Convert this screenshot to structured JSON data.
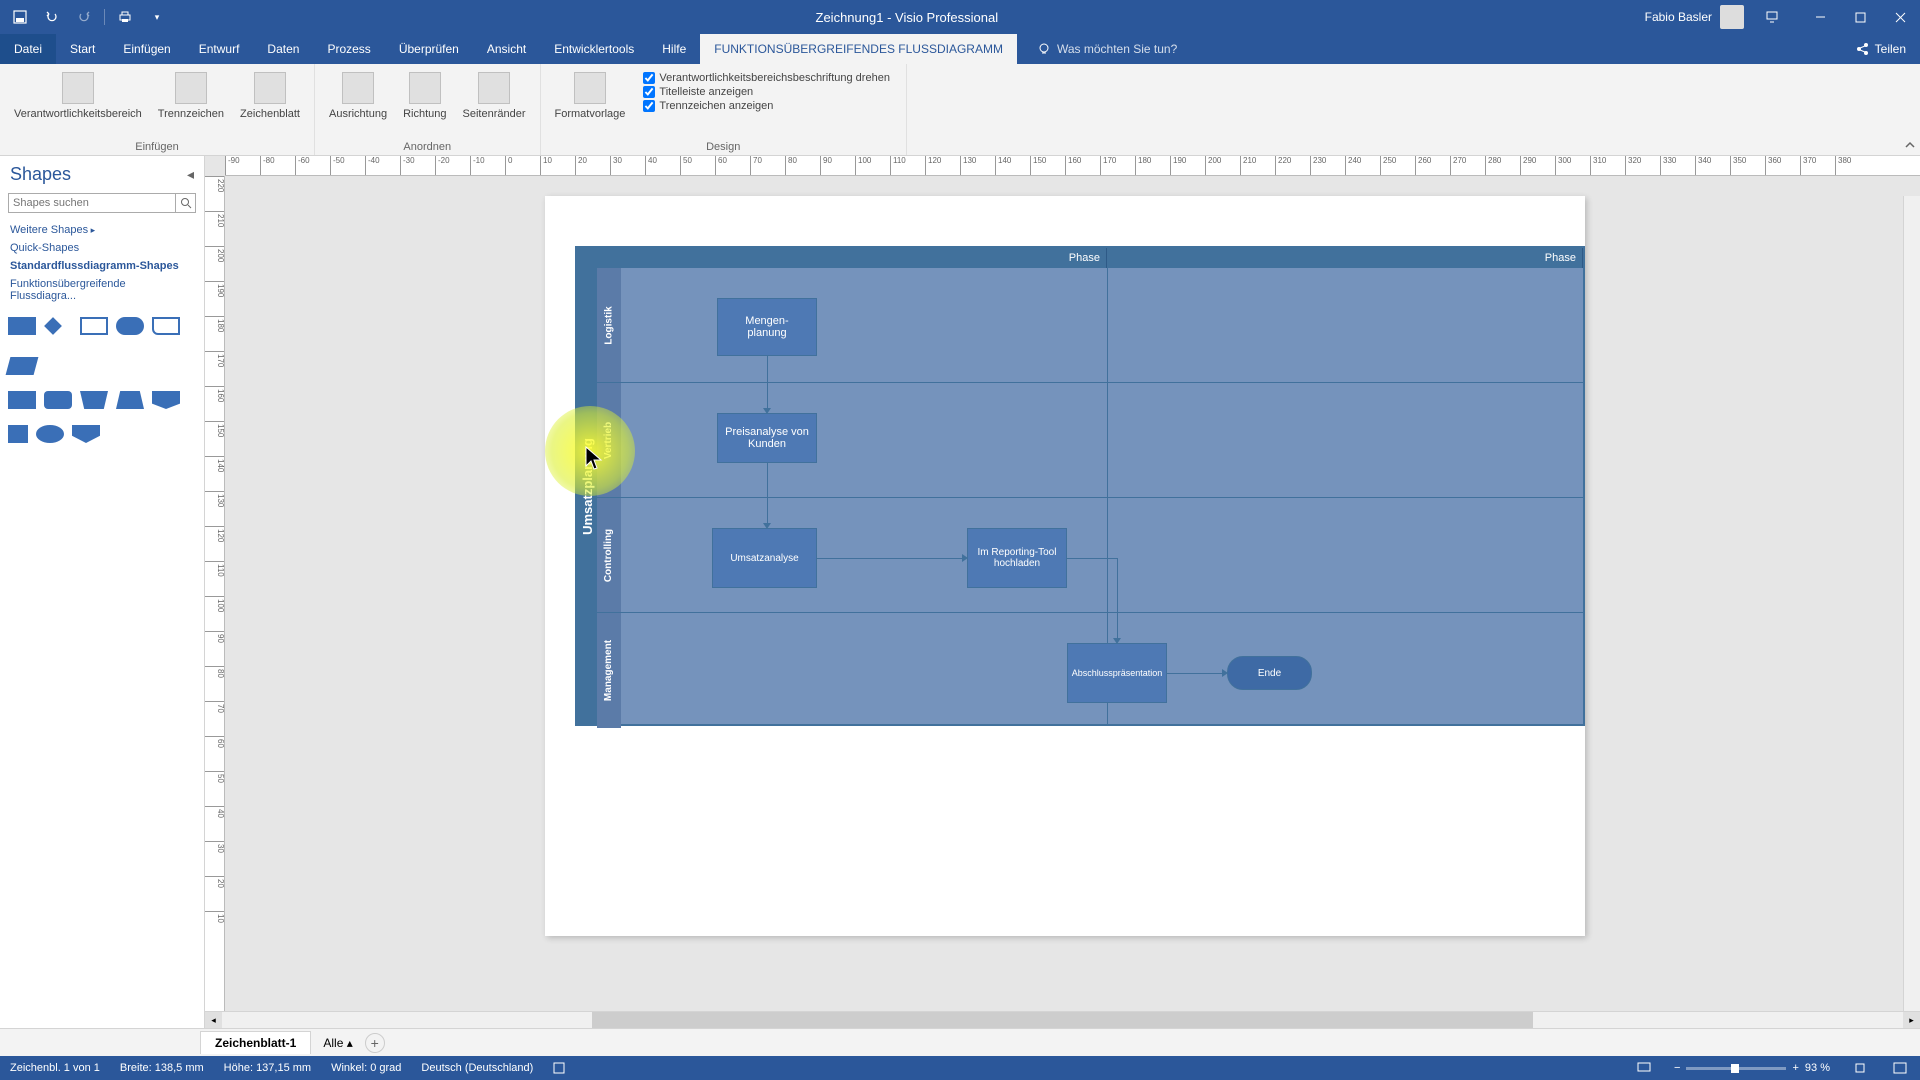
{
  "titlebar": {
    "title": "Zeichnung1 - Visio Professional",
    "user": "Fabio Basler"
  },
  "menu": {
    "tabs": [
      "Datei",
      "Start",
      "Einfügen",
      "Entwurf",
      "Daten",
      "Prozess",
      "Überprüfen",
      "Ansicht",
      "Entwicklertools",
      "Hilfe",
      "FUNKTIONSÜBERGREIFENDES FLUSSDIAGRAMM"
    ],
    "tell_me_placeholder": "Was möchten Sie tun?",
    "share": "Teilen"
  },
  "ribbon": {
    "insert_group": "Einfügen",
    "insert_buttons": [
      "Verantwortlichkeitsbereich",
      "Trennzeichen",
      "Zeichenblatt"
    ],
    "arrange_group": "Anordnen",
    "arrange_buttons": [
      "Ausrichtung",
      "Richtung",
      "Seitenränder"
    ],
    "design_group": "Design",
    "design_buttons": [
      "Formatvorlage"
    ],
    "design_checks": [
      "Verantwortlichkeitsbereichsbeschriftung drehen",
      "Titelleiste anzeigen",
      "Trennzeichen anzeigen"
    ]
  },
  "shapes": {
    "title": "Shapes",
    "search_placeholder": "Shapes suchen",
    "more": "Weitere Shapes",
    "quick": "Quick-Shapes",
    "stencils": [
      "Standardflussdiagramm-Shapes",
      "Funktionsübergreifende Flussdiagra..."
    ]
  },
  "diagram": {
    "swimlane_title": "Umsatzplanung",
    "phase_a": "Phase",
    "phase_b": "Phase",
    "lanes": [
      "Logistik",
      "Vertrieb",
      "Controlling",
      "Management"
    ],
    "boxes": {
      "mengen": "Mengen-\nplanung",
      "preis": "Preisanalyse von Kunden",
      "umsatz": "Umsatzanalyse",
      "report": "Im Reporting-Tool hochladen",
      "abschluss": "Abschlusspräsentation",
      "ende": "Ende"
    }
  },
  "page_tabs": {
    "sheet": "Zeichenblatt-1",
    "all": "Alle"
  },
  "status": {
    "page_info": "Zeichenbl. 1 von 1",
    "width": "Breite: 138,5 mm",
    "height": "Höhe: 137,15 mm",
    "angle": "Winkel: 0 grad",
    "lang": "Deutsch (Deutschland)",
    "zoom": "93 %"
  }
}
